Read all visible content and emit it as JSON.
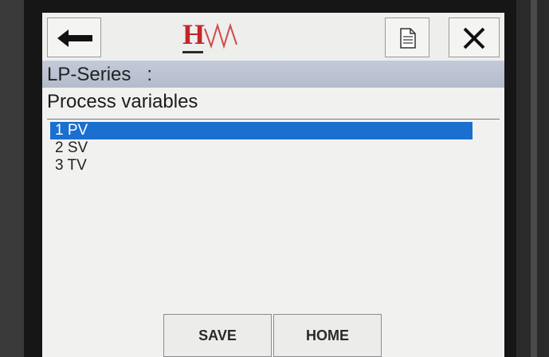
{
  "header": {
    "logo_letter": "H",
    "icons": [
      "back-arrow-icon",
      "document-icon",
      "close-icon"
    ]
  },
  "device_bar": {
    "label": "LP-Series   :"
  },
  "page": {
    "title": "Process variables"
  },
  "list": {
    "items": [
      {
        "label": "1 PV",
        "selected": true
      },
      {
        "label": "2 SV",
        "selected": false
      },
      {
        "label": "3 TV",
        "selected": false
      }
    ]
  },
  "softkeys": {
    "save_label": "SAVE",
    "home_label": "HOME"
  },
  "colors": {
    "selection": "#1a6fcf",
    "logo": "#c0262a",
    "device_bar": "#bcc3d2"
  }
}
